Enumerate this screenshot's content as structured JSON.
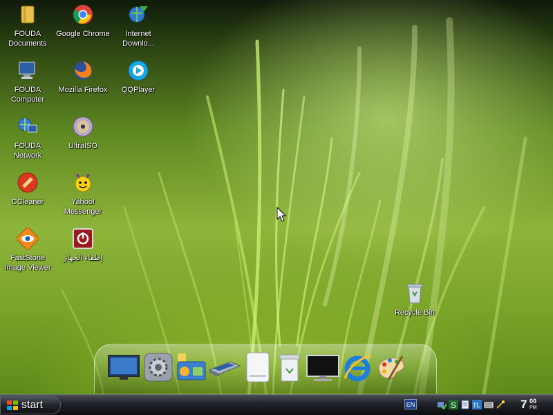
{
  "desktop_icons": [
    {
      "label": "FOUDA\nDocuments",
      "icon": "folder-icon"
    },
    {
      "label": "Google Chrome",
      "icon": "chrome-icon"
    },
    {
      "label": "Internet\nDownlo...",
      "icon": "internet-download-manager-icon"
    },
    {
      "label": "FOUDA\nComputer",
      "icon": "computer-icon"
    },
    {
      "label": "Mozilla Firefox",
      "icon": "firefox-icon"
    },
    {
      "label": "QQPlayer",
      "icon": "qqplayer-icon"
    },
    {
      "label": "FOUDA\nNetwork",
      "icon": "network-icon"
    },
    {
      "label": "UltraISO",
      "icon": "disc-icon"
    },
    {
      "label": "CCleaner",
      "icon": "ccleaner-icon"
    },
    {
      "label": "Yahoo!\nMessenger",
      "icon": "yahoo-messenger-icon"
    },
    {
      "label": "FastStone\nImage Viewer",
      "icon": "faststone-icon"
    },
    {
      "label": "إطفاء الجهاز",
      "icon": "shutdown-icon"
    },
    {
      "label": "Recycle Bin",
      "icon": "recycle-bin-icon"
    }
  ],
  "dock_items": [
    "monitor-icon",
    "settings-gears-icon",
    "control-panel-icon",
    "scanner-icon",
    "removable-drive-icon",
    "trash-can-icon",
    "display-icon",
    "internet-explorer-icon",
    "paint-palette-icon"
  ],
  "taskbar": {
    "start_label": "start",
    "language": "EN",
    "tray_icons": [
      "network-status-icon",
      "s-app-icon",
      "document-icon",
      "tl-app-icon",
      "keyboard-icon",
      "wand-icon"
    ],
    "clock": {
      "hour": "7",
      "minute": "00",
      "ampm": "PM"
    }
  },
  "colors": {
    "taskbar": "#1a1c20",
    "wallpaper": "#7aa42a"
  }
}
